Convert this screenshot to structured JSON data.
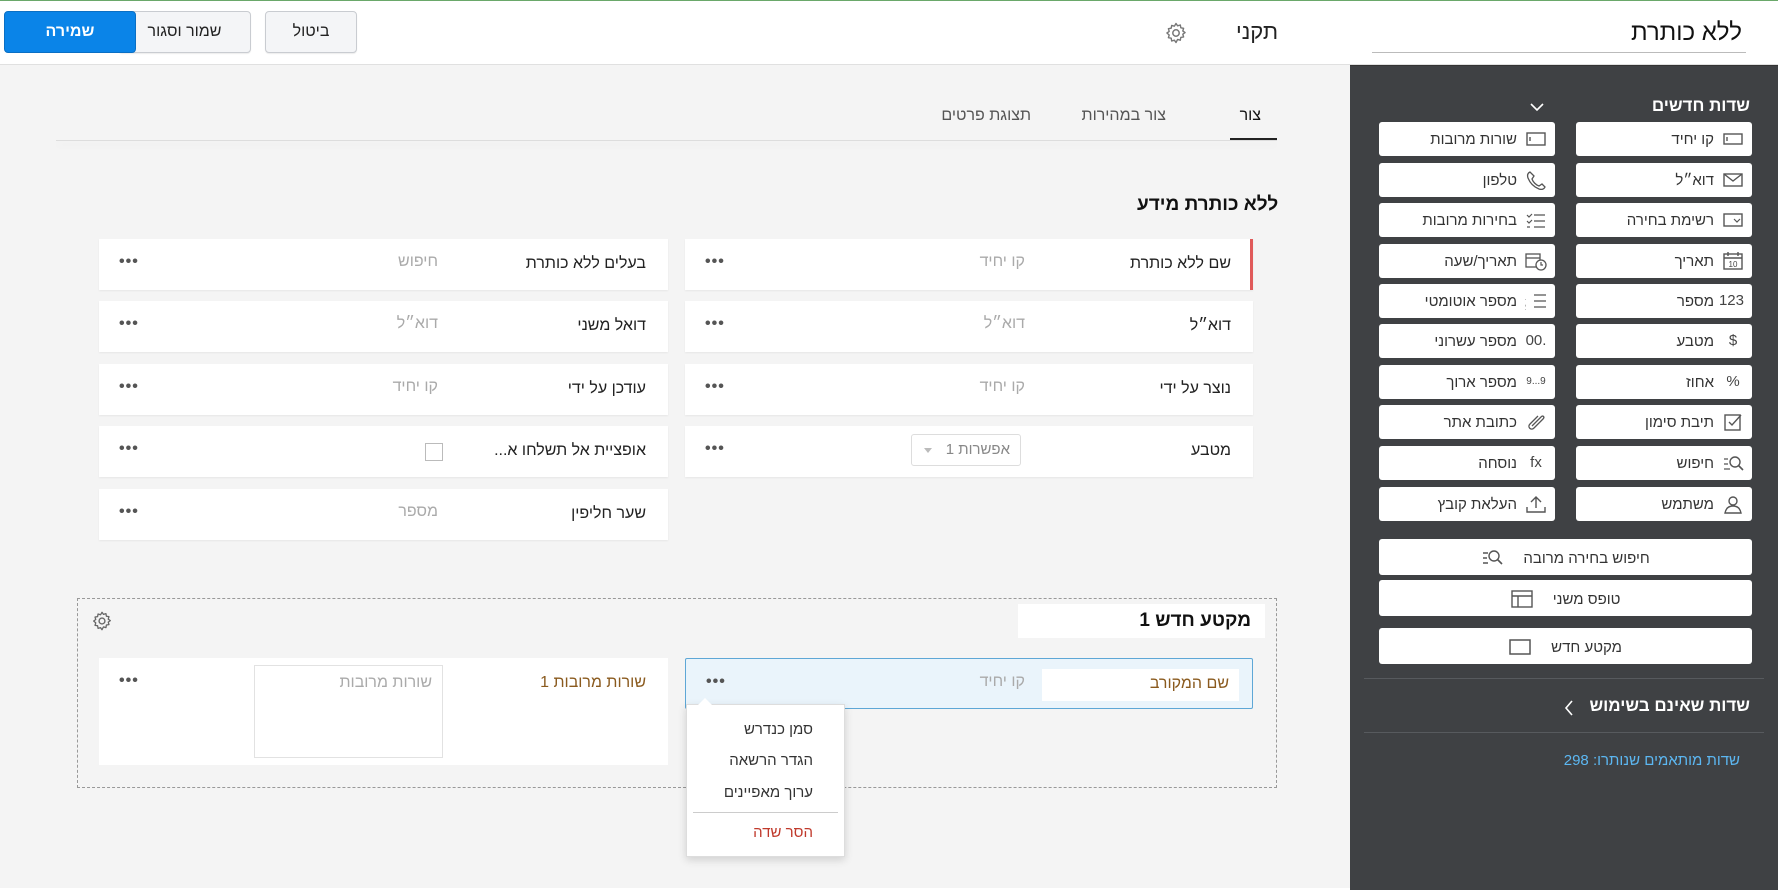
{
  "header": {
    "form_title": "ללא כותרת",
    "layout_name": "תקני",
    "save_label": "שמירה",
    "save_close_label": "שמור וסגור",
    "cancel_label": "ביטול",
    "accent_color": "#0a84e8"
  },
  "sidebar": {
    "new_fields_header": "שדות חדשים",
    "tiles": [
      {
        "label": "קו יחיד",
        "icon": "single-line-icon"
      },
      {
        "label": "שורות מרובות",
        "icon": "multi-line-icon"
      },
      {
        "label": "דוא״ל",
        "icon": "email-icon"
      },
      {
        "label": "טלפון",
        "icon": "phone-icon"
      },
      {
        "label": "רשימת בחירה",
        "icon": "picklist-icon"
      },
      {
        "label": "בחירות מרובות",
        "icon": "multi-select-icon"
      },
      {
        "label": "תאריך",
        "icon": "calendar-icon",
        "icon_text": "10"
      },
      {
        "label": "תאריך/שעה",
        "icon": "datetime-icon"
      },
      {
        "label": "מספר",
        "icon": "number-icon",
        "icon_text": "123"
      },
      {
        "label": "מספר אוטומטי",
        "icon": "auto-number-icon"
      },
      {
        "label": "מטבע",
        "icon": "currency-icon",
        "icon_text": "$"
      },
      {
        "label": "מספר עשרוני",
        "icon": "decimal-icon",
        "icon_text": ".00"
      },
      {
        "label": "אחוז",
        "icon": "percent-icon",
        "icon_text": "%"
      },
      {
        "label": "מספר ארוך",
        "icon": "long-number-icon",
        "icon_text": "9...9"
      },
      {
        "label": "תיבת סימון",
        "icon": "checkbox-icon"
      },
      {
        "label": "כתובת אתר",
        "icon": "url-icon"
      },
      {
        "label": "חיפוש",
        "icon": "lookup-icon"
      },
      {
        "label": "נוסחה",
        "icon": "formula-icon",
        "icon_text": "fx"
      },
      {
        "label": "משתמש",
        "icon": "user-icon"
      },
      {
        "label": "העלאת קובץ",
        "icon": "upload-icon"
      }
    ],
    "wide_tiles": [
      {
        "label": "חיפוש בחירה מרובה",
        "icon": "multi-lookup-icon"
      },
      {
        "label": "טופס משני",
        "icon": "subform-icon"
      },
      {
        "label": "מקטע חדש",
        "icon": "section-icon"
      }
    ],
    "unused_fields_header": "שדות שאינם בשימוש",
    "filtered_fields_label": "שדות מותאמים שנותרו:",
    "filtered_fields_count": "298",
    "link_color": "#5cb7f2"
  },
  "tabs": [
    {
      "label": "צור"
    },
    {
      "label": "צור במהירות"
    },
    {
      "label": "תצוגת פרטים"
    }
  ],
  "section1": {
    "title": "ללא כותרת מידע",
    "right_fields": [
      {
        "name": "שם ללא כותרת",
        "hint": "קו יחיד",
        "required": true
      },
      {
        "name": "דוא״ל",
        "hint": "דוא״ל"
      },
      {
        "name": "נוצר על ידי",
        "hint": "קו יחיד"
      },
      {
        "name": "מטבע",
        "select_value": "אפשרות 1"
      }
    ],
    "left_fields": [
      {
        "name": "בעלים ללא כותרת",
        "hint": "חיפוש"
      },
      {
        "name": "דואל משני",
        "hint": "דוא״ל"
      },
      {
        "name": "עודכן על ידי",
        "hint": "קו יחיד"
      },
      {
        "name": "אופציית אל תשלחו א..."
      },
      {
        "name": "שער חליפין",
        "hint": "מספר"
      }
    ],
    "dots": "•••",
    "required_color": "#e05a5a"
  },
  "section2": {
    "title": "מקטע חדש 1",
    "related_field": {
      "name": "שם המקורב",
      "hint": "קו יחיד"
    },
    "multi_field": {
      "name": "שורות מרובות 1",
      "hint": "שורות מרובות"
    }
  },
  "context_menu": {
    "items": [
      "סמן כנדרש",
      "הגדר הרשאה",
      "ערוך מאפיינים"
    ],
    "remove_label": "הסר שדה",
    "remove_color": "#c0392b"
  }
}
